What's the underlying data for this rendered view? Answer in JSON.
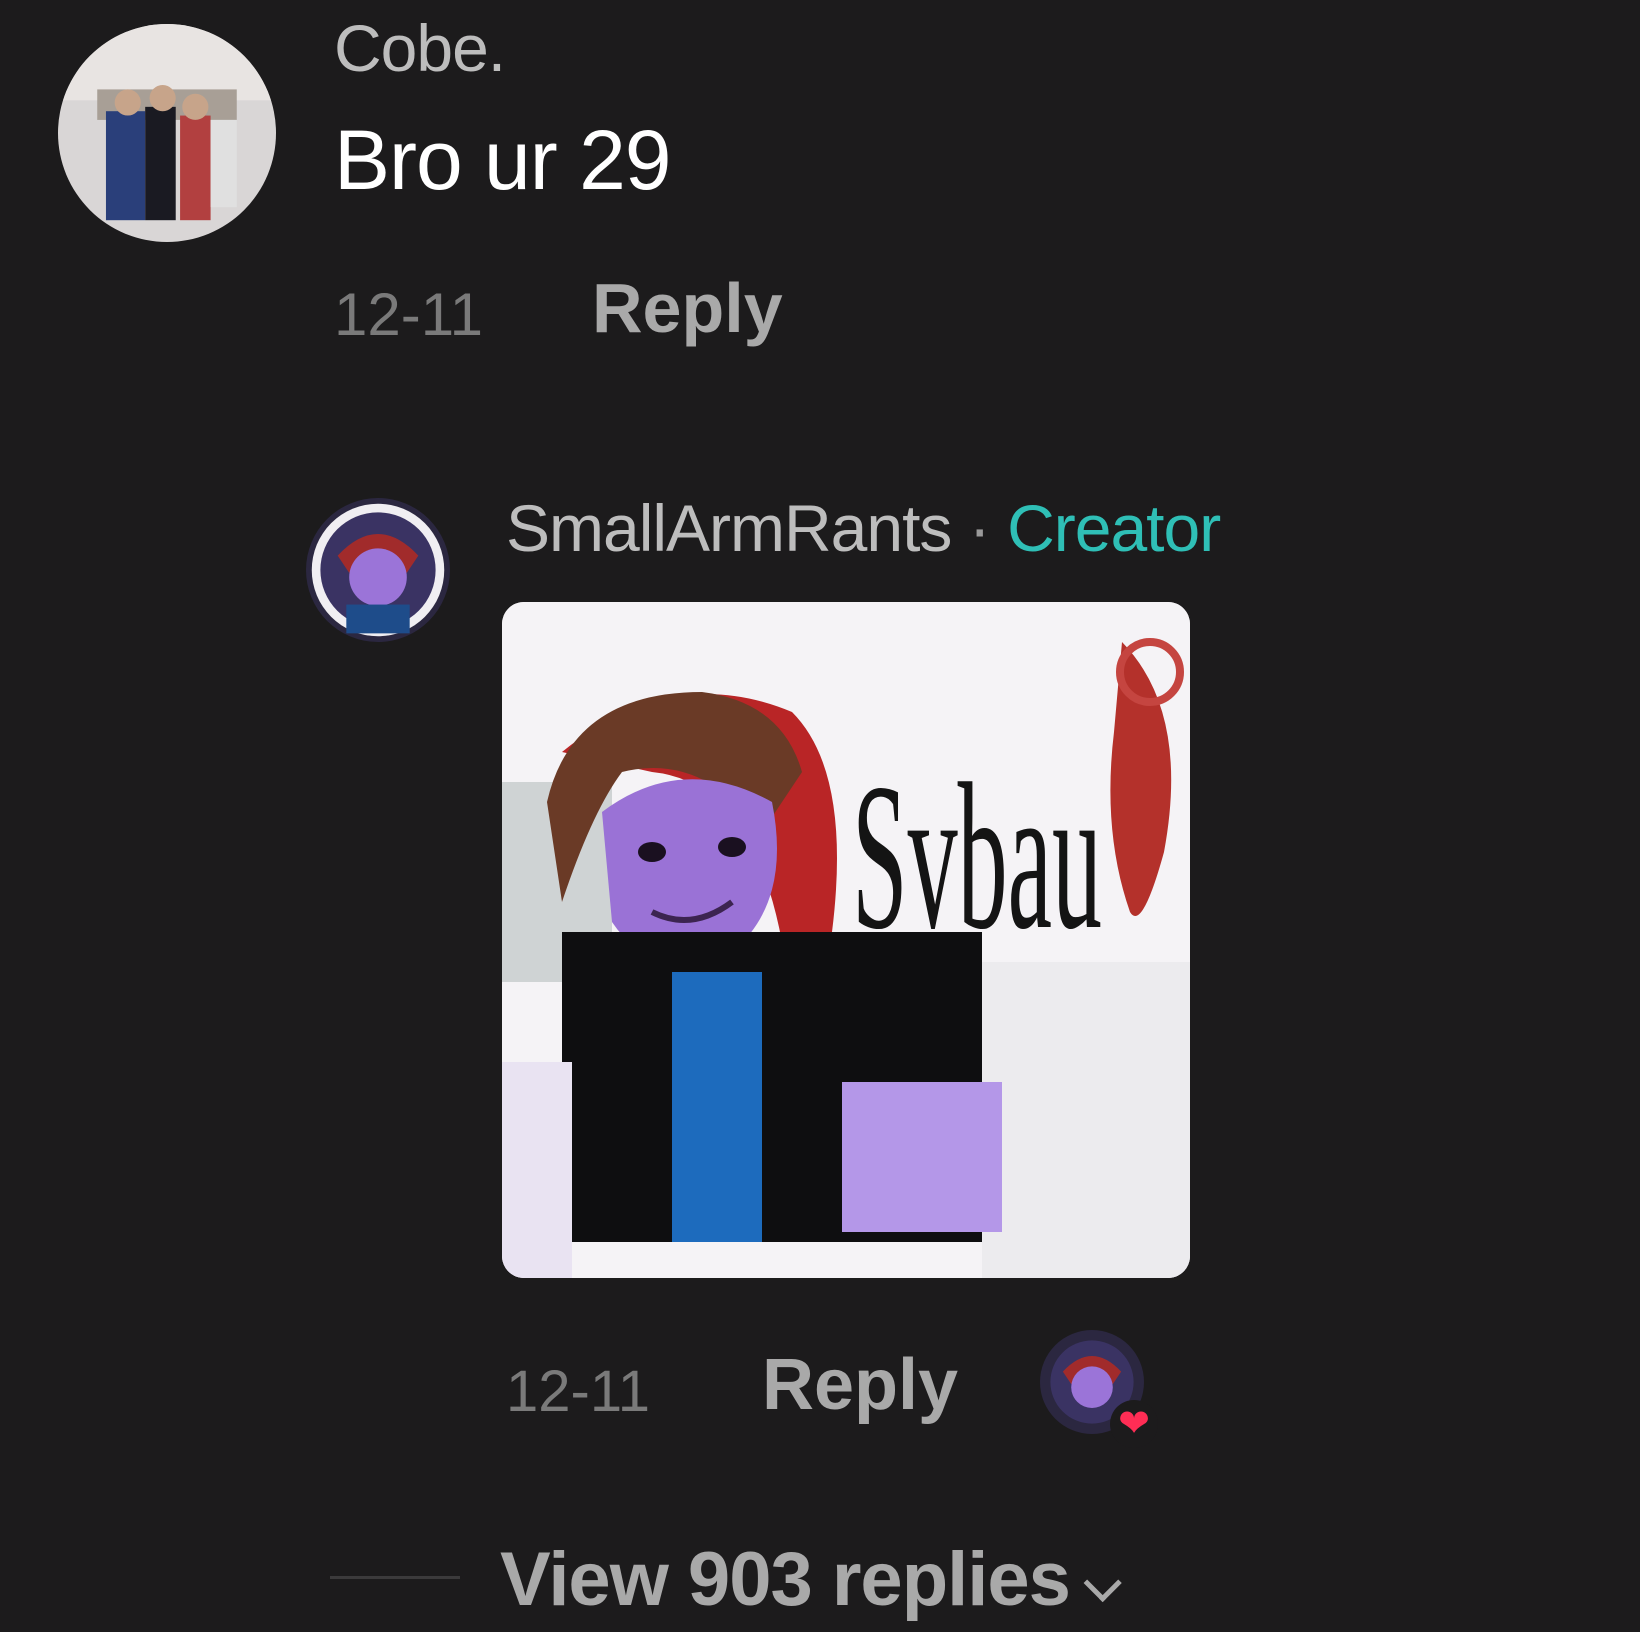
{
  "comment": {
    "username": "Cobe.",
    "text": "Bro ur 29",
    "date": "12-11",
    "reply_label": "Reply"
  },
  "creator_reply": {
    "username": "SmallArmRants",
    "separator": " · ",
    "role_badge": "Creator",
    "image_text": "Svbau",
    "date": "12-11",
    "reply_label": "Reply",
    "liked_icon": "heart-icon"
  },
  "view_replies": {
    "label": "View 903 replies",
    "icon": "chevron-down-icon"
  },
  "colors": {
    "background": "#1c1b1c",
    "creator_badge": "#2fbfb6",
    "like_heart": "#ff2d55"
  }
}
